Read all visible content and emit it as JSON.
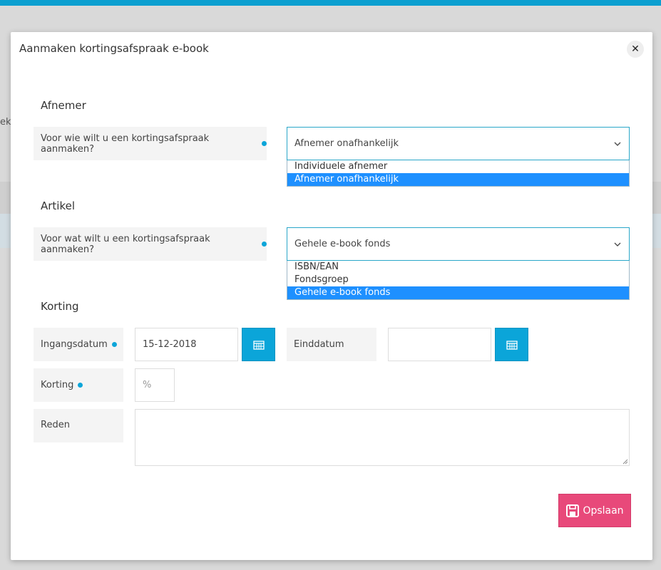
{
  "background": {
    "fragment_text": "ek"
  },
  "modal": {
    "title": "Aanmaken kortingsafspraak e-book",
    "close_symbol": "✕"
  },
  "afnemer": {
    "section_title": "Afnemer",
    "question": "Voor wie wilt u een kortingsafspraak aanmaken?",
    "selected": "Afnemer onafhankelijk",
    "options": [
      "Individuele afnemer",
      "Afnemer onafhankelijk"
    ],
    "selected_index": 1
  },
  "artikel": {
    "section_title": "Artikel",
    "question": "Voor wat wilt u een kortingsafspraak aanmaken?",
    "selected": "Gehele e-book fonds",
    "options": [
      "ISBN/EAN",
      "Fondsgroep",
      "Gehele e-book fonds"
    ],
    "selected_index": 2
  },
  "korting": {
    "section_title": "Korting",
    "ingangsdatum_label": "Ingangsdatum",
    "ingangsdatum_value": "15-12-2018",
    "einddatum_label": "Einddatum",
    "einddatum_value": "",
    "korting_label": "Korting",
    "korting_placeholder": "%",
    "reden_label": "Reden",
    "reden_value": ""
  },
  "actions": {
    "save_label": "Opslaan"
  },
  "colors": {
    "accent": "#0ba5d9",
    "save": "#e8497a",
    "option_selected": "#1e90ff"
  }
}
